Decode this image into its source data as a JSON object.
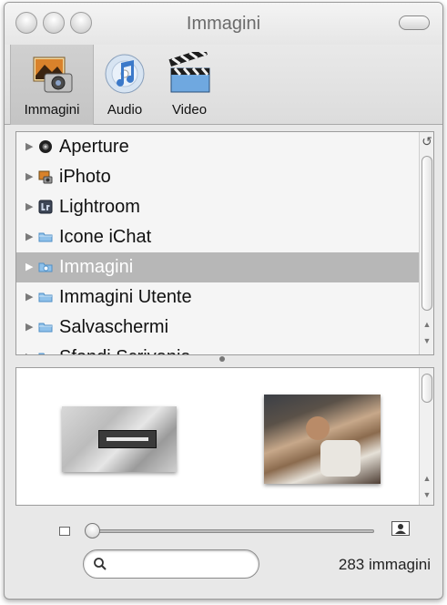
{
  "window": {
    "title": "Immagini"
  },
  "toolbar": {
    "items": [
      {
        "label": "Immagini",
        "icon": "photo-camera-icon",
        "selected": true
      },
      {
        "label": "Audio",
        "icon": "music-note-cd-icon",
        "selected": false
      },
      {
        "label": "Video",
        "icon": "clapperboard-icon",
        "selected": false
      }
    ]
  },
  "sources": {
    "items": [
      {
        "label": "Aperture",
        "icon": "aperture-lens-icon",
        "selected": false
      },
      {
        "label": "iPhoto",
        "icon": "iphoto-icon",
        "selected": false
      },
      {
        "label": "Lightroom",
        "icon": "lightroom-icon",
        "selected": false
      },
      {
        "label": "Icone iChat",
        "icon": "folder-icon",
        "selected": false
      },
      {
        "label": "Immagini",
        "icon": "folder-icon",
        "selected": true
      },
      {
        "label": "Immagini Utente",
        "icon": "folder-icon",
        "selected": false
      },
      {
        "label": "Salvaschermi",
        "icon": "folder-icon",
        "selected": false
      },
      {
        "label": "Sfondi Scrivania",
        "icon": "folder-icon",
        "selected": false
      }
    ]
  },
  "footer": {
    "count": "283 immagini",
    "search_placeholder": "",
    "zoom_level": 0.0
  },
  "colors": {
    "selection_row": "#b7b7b7",
    "window_bg": "#e8e8e8"
  }
}
